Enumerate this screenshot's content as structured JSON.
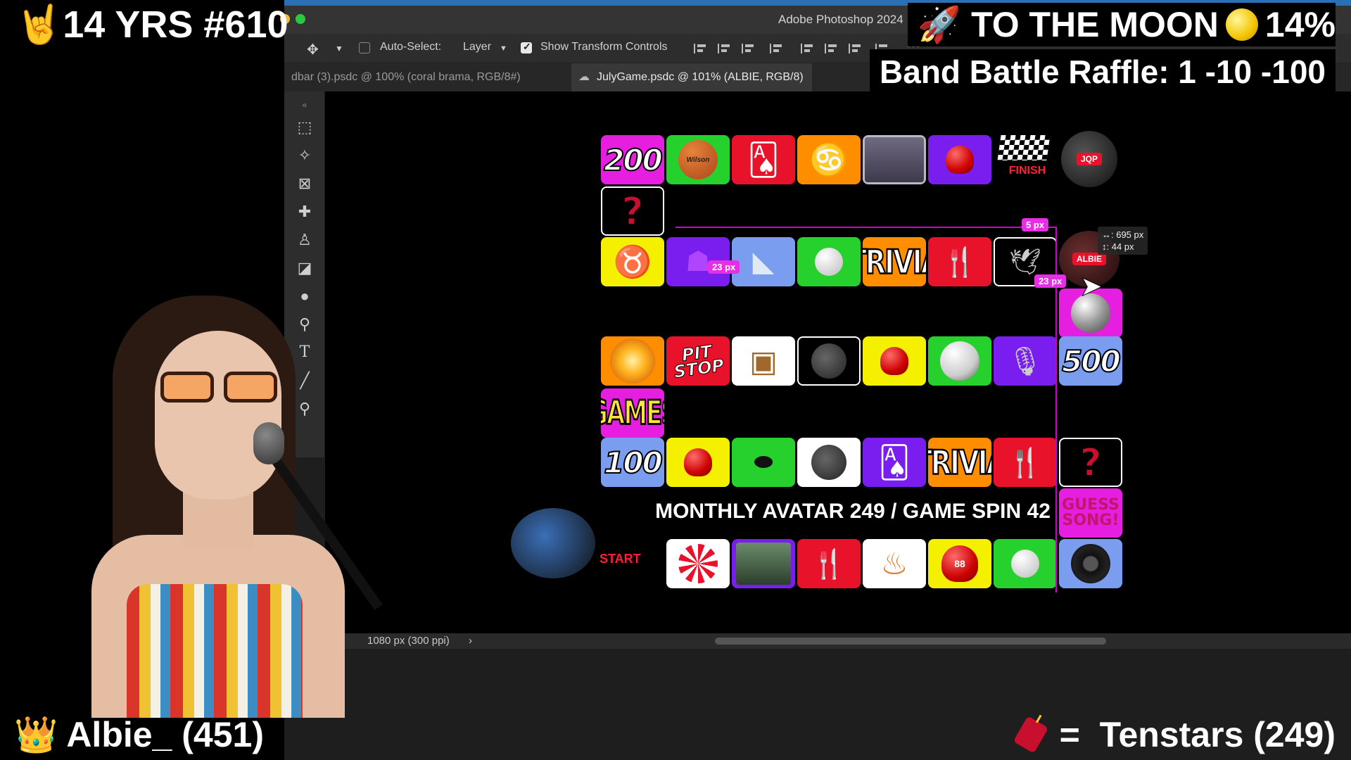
{
  "overlays": {
    "anniversary": "14 YRS #610",
    "moon_left": "TO THE MOON",
    "moon_right": "14%",
    "raffle": "Band Battle Raffle: 1 -10 -100",
    "user_left": "Albie_ (451)",
    "user_right_eq": "=",
    "user_right": "Tenstars (249)"
  },
  "photoshop": {
    "app_title": "Adobe Photoshop 2024",
    "options": {
      "auto_select_label": "Auto-Select:",
      "auto_select_value": "Layer",
      "show_transform_label": "Show Transform Controls"
    },
    "tabs": [
      {
        "label": "dbar (3).psdc @ 100% (coral brama, RGB/8#)"
      },
      {
        "label": "JulyGame.psdc @ 101% (ALBIE, RGB/8)"
      }
    ],
    "status": "1080 px (300 ppi)",
    "status_arrow": "›"
  },
  "board": {
    "tiles": {
      "n200": "200",
      "n500": "500",
      "n100": "100",
      "trivia": "TRIVIA",
      "games": "GAMES",
      "pit_stop_1": "PIT",
      "pit_stop_2": "STOP",
      "guess_1": "GUESS",
      "guess_2": "SONG!",
      "finish": "FINISH",
      "start": "START",
      "qmark": "?",
      "albie": "ALBIE",
      "jqp": "JQP",
      "wilson": "Wilson",
      "racer_num": "88"
    },
    "measures": {
      "gap_top": "5 px",
      "gap_left": "23 px",
      "gap_right": "23 px",
      "readout_w": "↔: 695 px",
      "readout_h": "↕: 44 px"
    },
    "banner": "MONTHLY AVATAR 249 / GAME SPIN 42"
  },
  "colors": {
    "magenta": "#e51ee0",
    "green": "#26d12e",
    "red": "#e8132b",
    "orange": "#ff8d00",
    "purple": "#7a1ef0",
    "yellow": "#f4f000",
    "blue": "#7a9df0",
    "guide": "#d100d1"
  }
}
